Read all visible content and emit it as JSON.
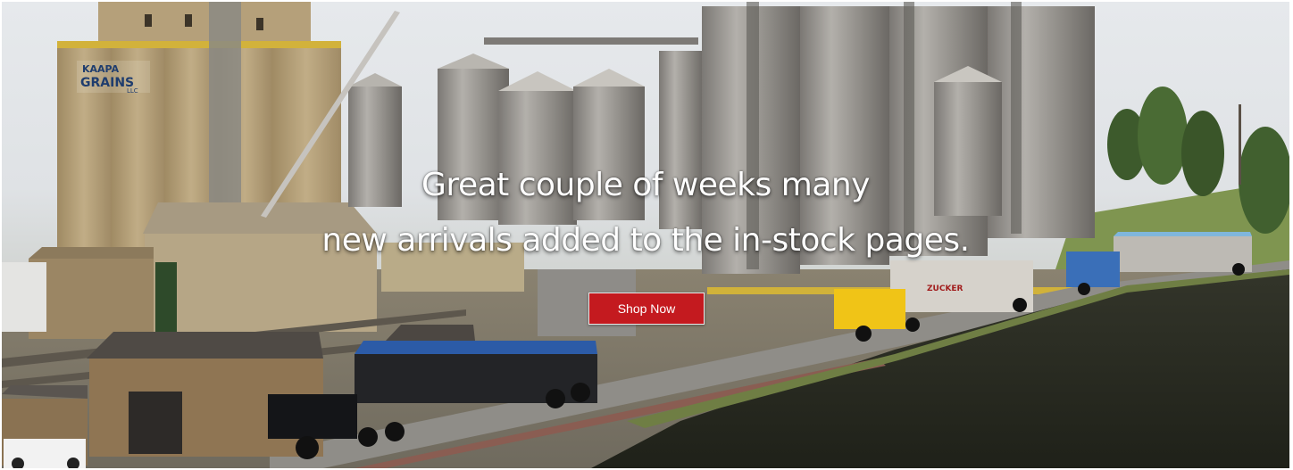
{
  "hero": {
    "headline_line1": "Great couple of weeks many",
    "headline_line2": "new arrivals added to the in-stock pages.",
    "cta_label": "Shop Now",
    "elevator_sign_line1": "KAAPA",
    "elevator_sign_line2": "GRAINS",
    "elevator_sign_line3": "LLC",
    "trailer_sign": "ZUCKER"
  },
  "colors": {
    "cta_background": "#c41a1f",
    "headline_text": "#ffffff",
    "water": "#2a2c20",
    "silo_metal": "#9c9893",
    "elevator_concrete": "#b19d78"
  }
}
